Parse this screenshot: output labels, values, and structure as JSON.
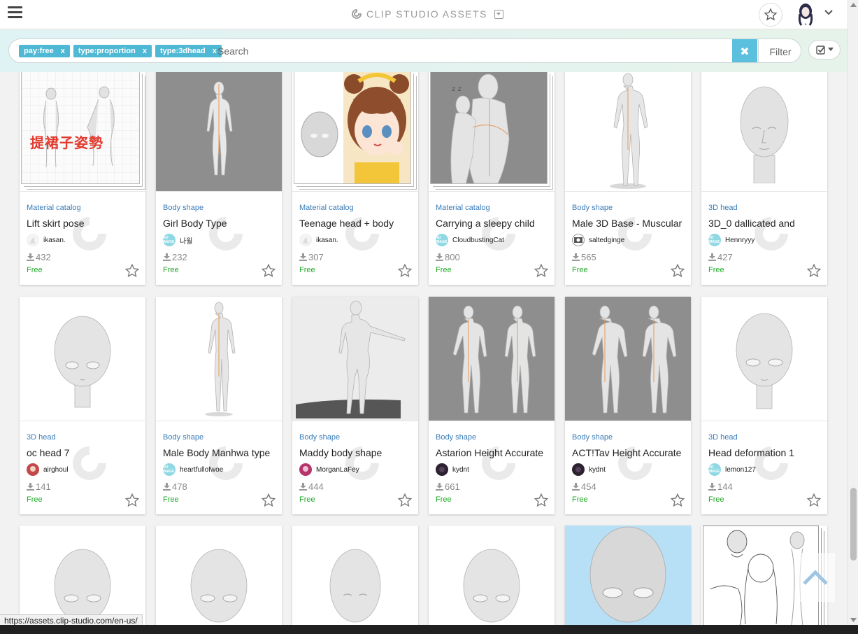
{
  "header": {
    "brand": "CLIP STUDIO ASSETS"
  },
  "search": {
    "tags": [
      {
        "label": "pay:free",
        "remove": "x"
      },
      {
        "label": "type:proportion",
        "remove": "x"
      },
      {
        "label": "type:3dhead",
        "remove": "x"
      }
    ],
    "placeholder": "Search",
    "clear_icon": "✖",
    "filter_label": "Filter"
  },
  "cards": [
    {
      "category": "Material catalog",
      "title": "Lift skirt pose",
      "author": "ikasan.",
      "downloads": "432",
      "price": "Free",
      "thumb_text": "提裙子姿勢"
    },
    {
      "category": "Body shape",
      "title": "Girl Body Type",
      "author": "나윌",
      "downloads": "232",
      "price": "Free"
    },
    {
      "category": "Material catalog",
      "title": "Teenage head + body",
      "author": "ikasan.",
      "downloads": "307",
      "price": "Free"
    },
    {
      "category": "Material catalog",
      "title": "Carrying a sleepy child",
      "author": "CloudbustingCat",
      "downloads": "800",
      "price": "Free"
    },
    {
      "category": "Body shape",
      "title": "Male 3D Base - Muscular",
      "author": "saltedginge",
      "downloads": "565",
      "price": "Free"
    },
    {
      "category": "3D head",
      "title": "3D_0 dallicated and",
      "author": "Hennryyy",
      "downloads": "427",
      "price": "Free"
    },
    {
      "category": "3D head",
      "title": "oc head 7",
      "author": "airghoul",
      "downloads": "141",
      "price": "Free"
    },
    {
      "category": "Body shape",
      "title": "Male Body Manhwa type",
      "author": "heartfullofwoe",
      "downloads": "478",
      "price": "Free"
    },
    {
      "category": "Body shape",
      "title": "Maddy body shape",
      "author": "MorganLaFey",
      "downloads": "444",
      "price": "Free"
    },
    {
      "category": "Body shape",
      "title": "Astarion Height Accurate",
      "author": "kydnt",
      "downloads": "661",
      "price": "Free"
    },
    {
      "category": "Body shape",
      "title": "ACT!Tav Height Accurate",
      "author": "kydnt",
      "downloads": "454",
      "price": "Free"
    },
    {
      "category": "3D head",
      "title": "Head deformation 1",
      "author": "lemon127",
      "downloads": "144",
      "price": "Free"
    }
  ],
  "avatar_badge": "NO IMAGE",
  "status_url": "https://assets.clip-studio.com/en-us/",
  "colors": {
    "accent": "#5bc0de",
    "tag": "#4fb8d4",
    "category": "#3a7db8",
    "free": "#22a82a"
  }
}
